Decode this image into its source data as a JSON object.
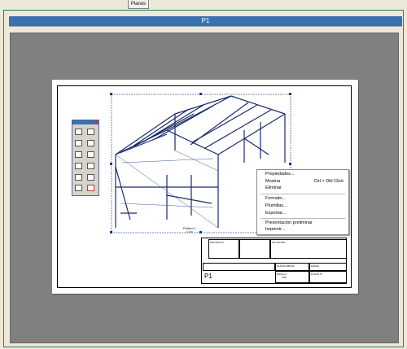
{
  "tab": {
    "label": "Planos"
  },
  "window": {
    "title": "P1"
  },
  "drawing": {
    "caption": "Pórtico 1",
    "caption_scale": "1:100"
  },
  "title_block": {
    "cell_project": "PROYECTO",
    "cell_situation": "SITUACIÓN",
    "cell_draft": "PLANO DIBUJO",
    "cell_date": "FECHA",
    "cell_scale": "ESCALA",
    "cell_scale_value": "1:80",
    "cell_number": "PLANO Nº",
    "sheet_name": "P1"
  },
  "context_menu": {
    "items": [
      {
        "label": "Propiedades...",
        "shortcut": ""
      },
      {
        "label": "Mostrar",
        "shortcut": "Ctrl + Dbl Click"
      },
      {
        "label": "Eliminar",
        "shortcut": ""
      },
      {
        "label": "Formato...",
        "shortcut": ""
      },
      {
        "label": "Plumillas...",
        "shortcut": ""
      },
      {
        "label": "Exportar...",
        "shortcut": ""
      },
      {
        "label": "Presentación preliminar",
        "shortcut": ""
      },
      {
        "label": "Imprimir...",
        "shortcut": ""
      }
    ]
  },
  "colors": {
    "title_bar": "#3a6fb0",
    "canvas": "#808080",
    "frame_border": "#2c7a6a"
  }
}
